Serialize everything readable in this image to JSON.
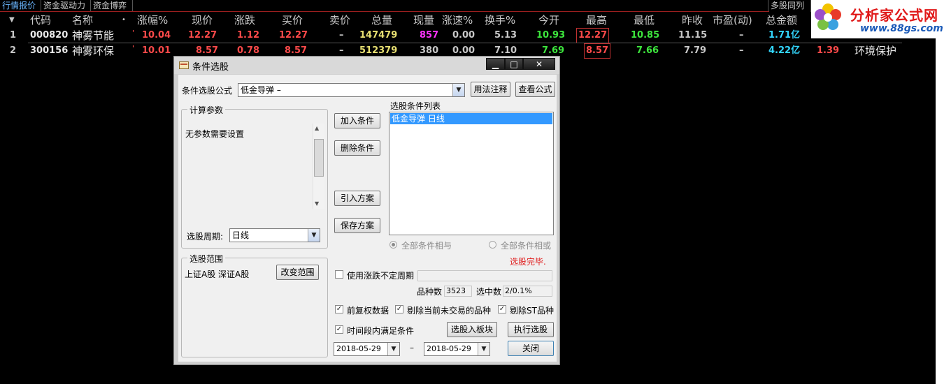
{
  "tabs": [
    "行情报价",
    "资金驱动力",
    "资金博弈"
  ],
  "right_tab": "多股同列",
  "logo": {
    "name": "分析家公式网",
    "url": "www.88gs.com"
  },
  "columns": [
    "代码",
    "名称",
    "涨幅%",
    "现价",
    "涨跌",
    "买价",
    "卖价",
    "总量",
    "现量",
    "涨速%",
    "换手%",
    "今开",
    "最高",
    "最低",
    "昨收",
    "市盈(动)",
    "总金额"
  ],
  "rows": [
    {
      "idx": "1",
      "code": "000820",
      "name": "神雾节能",
      "chg_pct": "10.04",
      "price": "12.27",
      "chg": "1.12",
      "bid": "12.27",
      "ask": "–",
      "volume": "147479",
      "cur_vol": "857",
      "speed": "0.00",
      "turnover": "5.13",
      "open": "10.93",
      "high": "12.27",
      "low": "10.85",
      "prev_close": "11.15",
      "pe": "–",
      "amount": "1.71亿"
    },
    {
      "idx": "2",
      "code": "300156",
      "name": "神雾环保",
      "chg_pct": "10.01",
      "price": "8.57",
      "chg": "0.78",
      "bid": "8.57",
      "ask": "–",
      "volume": "512379",
      "cur_vol": "380",
      "speed": "0.00",
      "turnover": "7.10",
      "open": "7.69",
      "high": "8.57",
      "low": "7.66",
      "prev_close": "7.79",
      "pe": "–",
      "amount": "4.22亿",
      "extra_num": "1.39",
      "industry": "环境保护"
    }
  ],
  "dialog": {
    "title": "条件选股",
    "formula_label": "条件选股公式",
    "formula_value": "低金导弹        –",
    "usage_button": "用法注释",
    "view_formula_button": "查看公式",
    "params_group": "计算参数",
    "params_text": "无参数需要设置",
    "period_label": "选股周期:",
    "period_value": "日线",
    "range_group": "选股范围",
    "range_text": "上证A股 深证A股",
    "change_range_button": "改变范围",
    "add_condition_button": "加入条件",
    "delete_condition_button": "删除条件",
    "import_plan_button": "引入方案",
    "save_plan_button": "保存方案",
    "condition_list_label": "选股条件列表",
    "condition_items": [
      "低金导弹  日线"
    ],
    "radio_and": "全部条件相与",
    "radio_or": "全部条件相或",
    "status": "选股完毕.",
    "use_variable_period": "使用涨跌不定周期",
    "count_label": "品种数",
    "count_value": "3523",
    "selected_label": "选中数",
    "selected_value": "2/0.1%",
    "check_prior_adjust": "前复权数据",
    "check_exclude_untraded": "剔除当前未交易的品种",
    "check_exclude_st": "剔除ST品种",
    "check_time_range": "时间段内满足条件",
    "to_block_button": "选股入板块",
    "execute_button": "执行选股",
    "start_date": "2018-05-29",
    "end_date": "2018-05-29",
    "date_sep": "–",
    "close_button": "关闭"
  },
  "colors": {
    "up": "#ff4a4a",
    "down_green": "#3de63d",
    "cyan": "#33d7ff",
    "magenta": "#ff33ff",
    "selection": "#3399ff"
  }
}
